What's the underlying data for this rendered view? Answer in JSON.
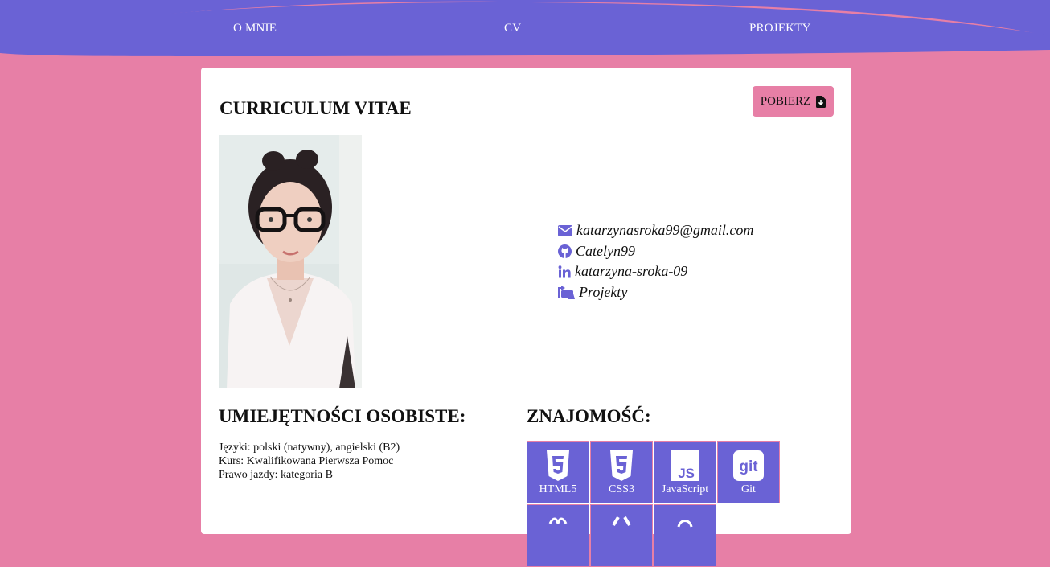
{
  "nav": {
    "items": [
      "O MNIE",
      "CV",
      "PROJEKTY"
    ]
  },
  "cv": {
    "title": "CURRICULUM VITAE",
    "download_label": "POBIERZ",
    "contacts": [
      {
        "icon": "envelope-icon",
        "text": "katarzynasroka99@gmail.com"
      },
      {
        "icon": "github-icon",
        "text": "Catelyn99"
      },
      {
        "icon": "linkedin-icon",
        "text": "katarzyna-sroka-09"
      },
      {
        "icon": "projects-icon",
        "text": "Projekty"
      }
    ]
  },
  "skills": {
    "title": "UMIEJĘTNOŚCI OSOBISTE:",
    "lines": [
      "Języki: polski (natywny), angielski (B2)",
      "Kurs: Kwalifikowana Pierwsza Pomoc",
      "Prawo jazdy: kategoria B"
    ]
  },
  "knowledge": {
    "title": "ZNAJOMOŚĆ:",
    "tiles": [
      {
        "icon": "html5-icon",
        "label": "HTML5"
      },
      {
        "icon": "css3-icon",
        "label": "CSS3"
      },
      {
        "icon": "javascript-icon",
        "label": "JavaScript"
      },
      {
        "icon": "git-icon",
        "label": "Git"
      }
    ]
  },
  "colors": {
    "accent": "#6a62d5",
    "background": "#e77fa6",
    "card": "#ffffff"
  }
}
